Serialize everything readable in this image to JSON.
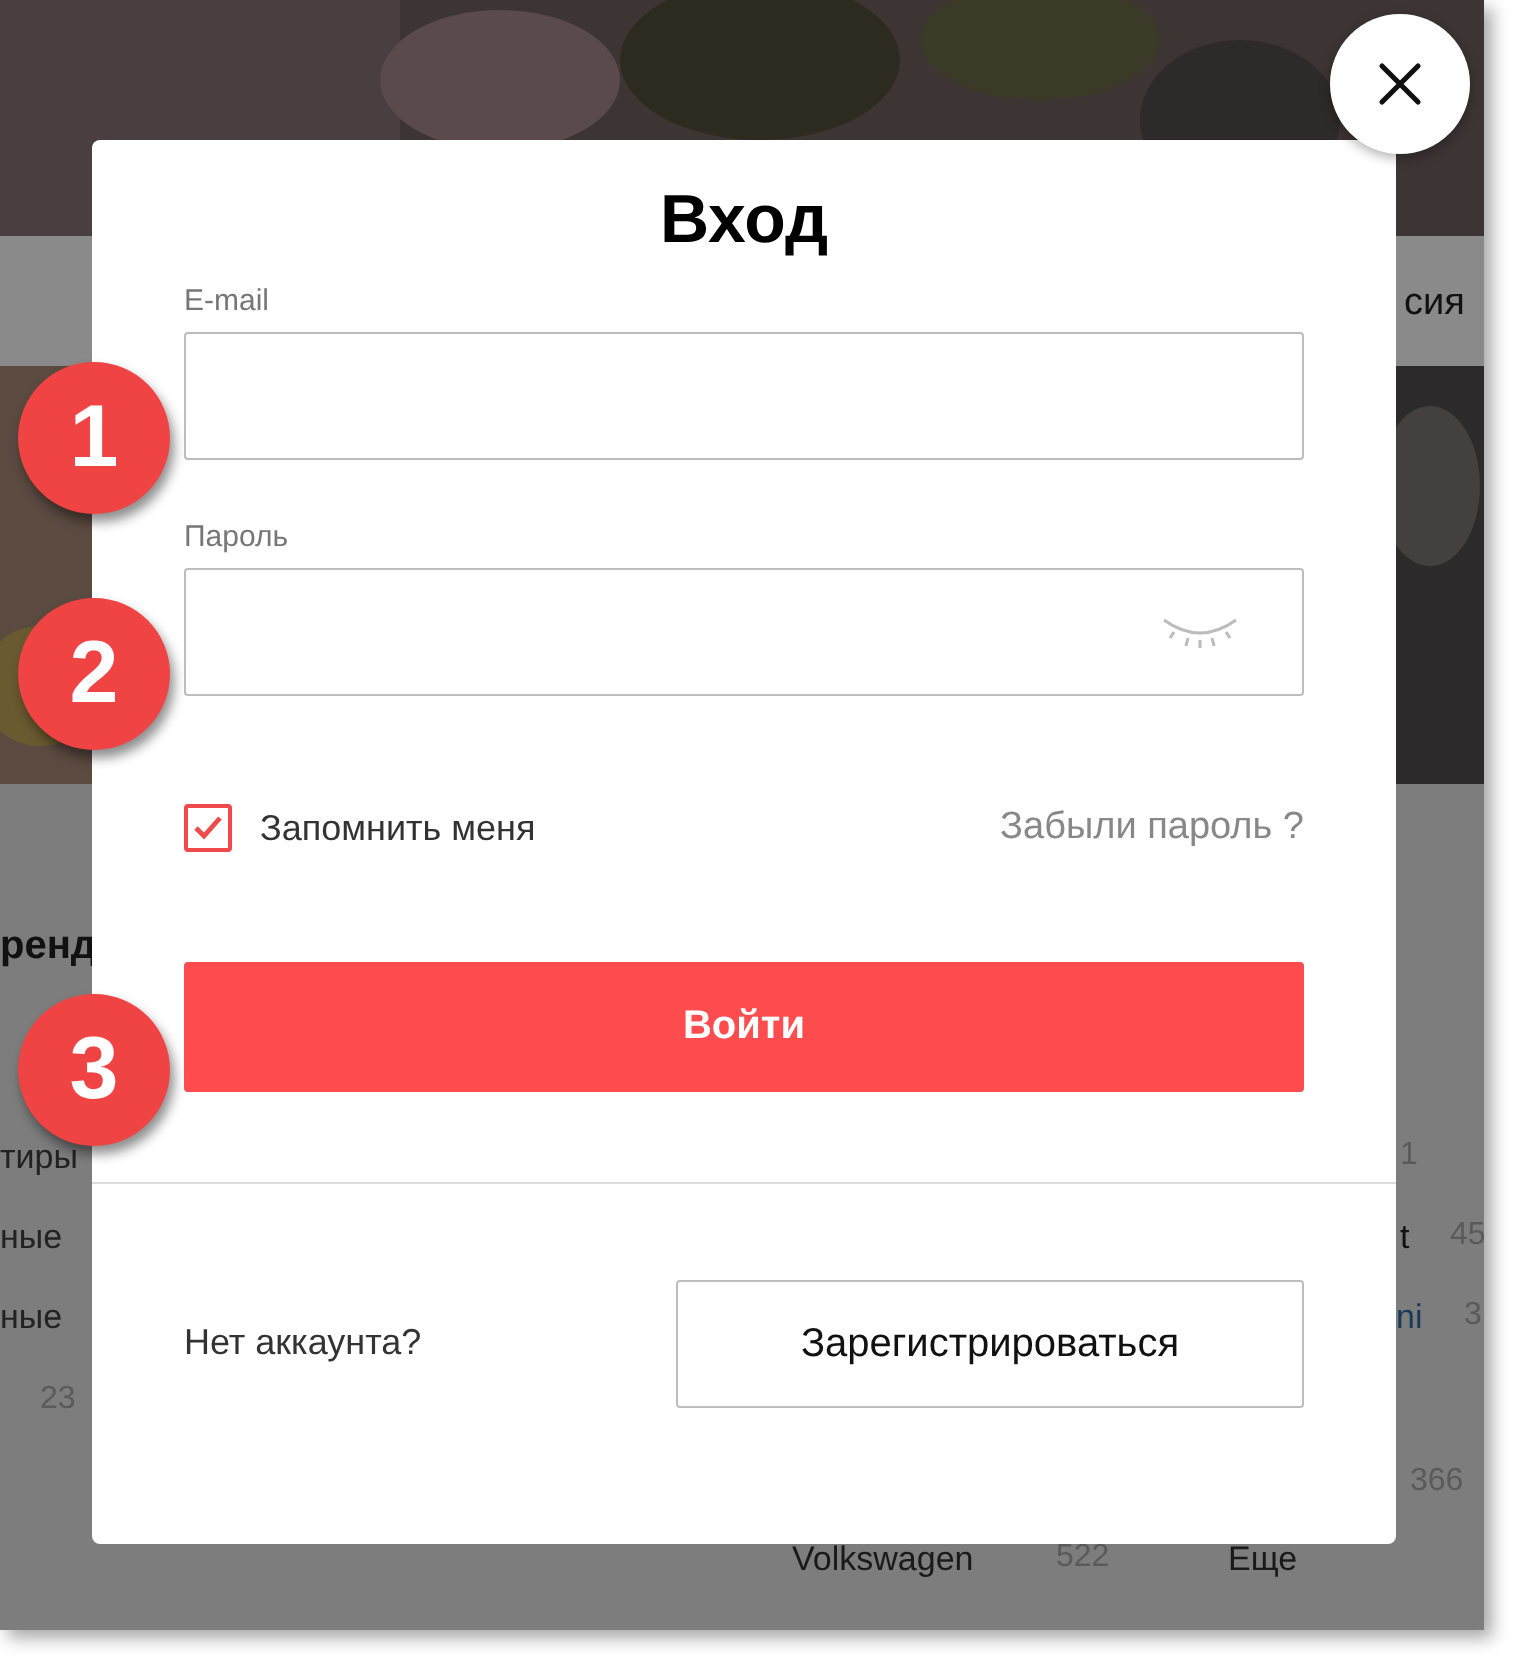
{
  "background": {
    "tab_fragment": "сия",
    "left_texts": [
      "ренд",
      "тиры",
      "ные",
      "ные",
      "23"
    ],
    "right_texts": [
      "1",
      "t",
      "45",
      "ni",
      "3",
      "366"
    ],
    "bottom_texts": [
      "Volkswagen",
      "522",
      "Еще"
    ]
  },
  "modal": {
    "title": "Вход",
    "fields": [
      {
        "label": "E-mail",
        "kind": "text"
      },
      {
        "label": "Пароль",
        "kind": "password"
      }
    ],
    "remember": {
      "label": "Запомнить меня",
      "checked": true
    },
    "forgot_link": "Забыли пароль ?",
    "submit": "Войти",
    "no_account": "Нет аккаунта?",
    "register": "Зарегистрироваться"
  },
  "markers": [
    "1",
    "2",
    "3"
  ]
}
